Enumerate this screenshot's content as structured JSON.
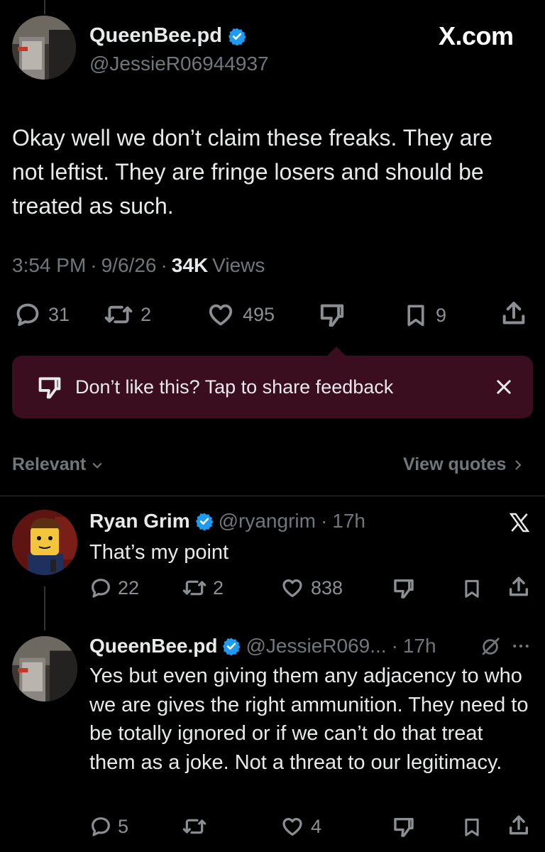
{
  "main_tweet": {
    "display_name": "QueenBee.pd",
    "handle": "@JessieR06944937",
    "watermark": "X.com",
    "text": "Okay well we don’t claim these freaks. They are not leftist. They are fringe losers and should be treated as such.",
    "time": "3:54 PM",
    "sep1": "·",
    "date": "9/6/26",
    "sep2": "·",
    "views_count": "34K",
    "views_label": "Views",
    "replies": "31",
    "reposts": "2",
    "likes": "495",
    "bookmarks": "9"
  },
  "feedback_banner": {
    "text": "Don’t like this? Tap to share feedback",
    "bg_color": "#3a0d1f"
  },
  "sort_bar": {
    "sort_label": "Relevant",
    "quotes_label": "View quotes"
  },
  "replies": [
    {
      "display_name": "Ryan Grim",
      "handle": "@ryangrim",
      "sep": "·",
      "time": "17h",
      "text": "That’s my point",
      "replies": "22",
      "reposts": "2",
      "likes": "838"
    },
    {
      "display_name": "QueenBee.pd",
      "handle": "@JessieR069...",
      "sep": "·",
      "time": "17h",
      "text": "Yes but even giving them any adjacency to who we are gives the right ammunition. They need to be totally ignored or if we can’t do that treat them as a joke. Not a threat to our legitimacy.",
      "replies": "5",
      "likes": "4"
    }
  ],
  "colors": {
    "accent": "#1d9bf0",
    "muted": "#71767b",
    "background": "#000000"
  }
}
